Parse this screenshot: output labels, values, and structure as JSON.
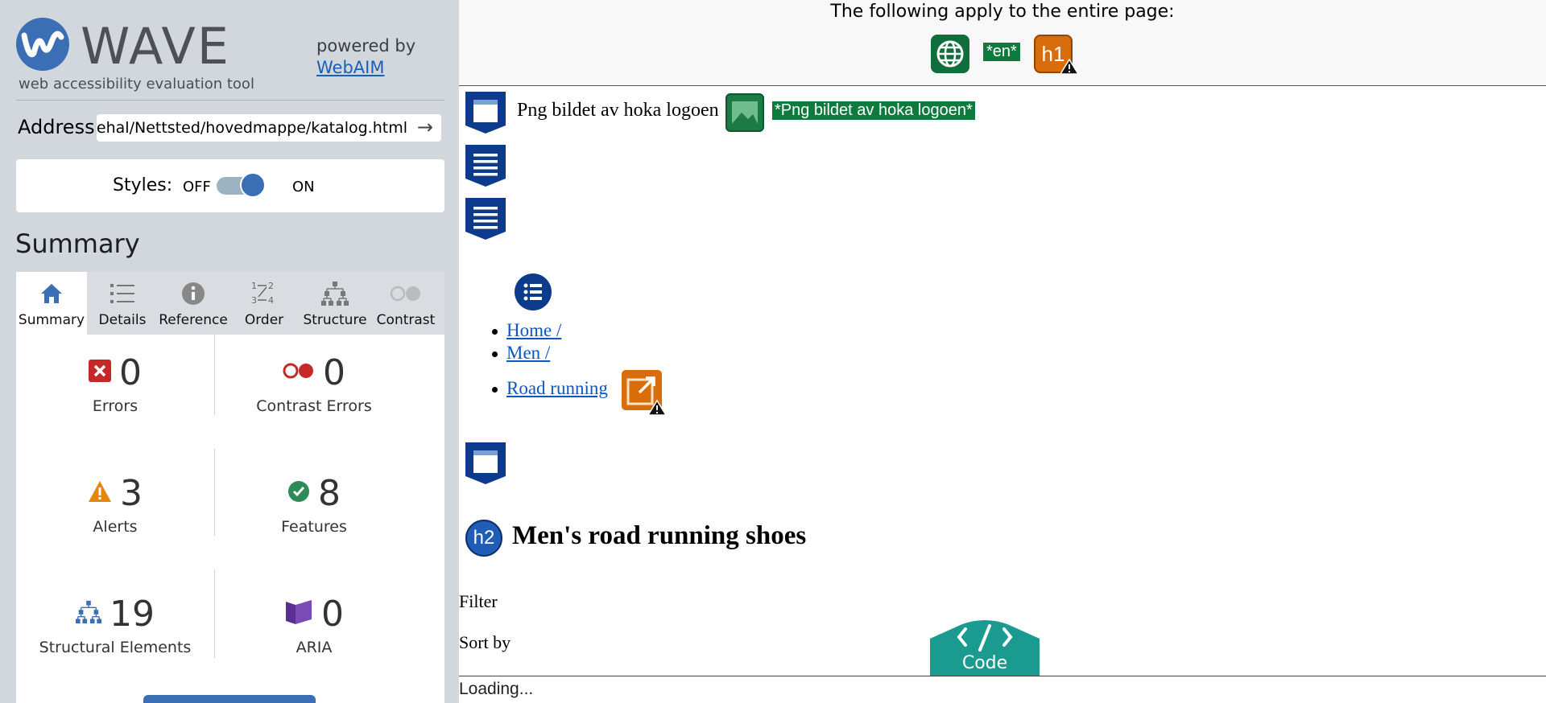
{
  "app": {
    "logo_text": "WAVE",
    "tagline": "web accessibility evaluation tool",
    "powered_by": "powered by",
    "powered_link": "WebAIM"
  },
  "address": {
    "label": "Address:",
    "value": "artehal/Nettsted/hovedmappe/katalog.html",
    "go_icon": "arrow-right-icon"
  },
  "styles": {
    "label": "Styles:",
    "off": "OFF",
    "on": "ON",
    "state": "on"
  },
  "summary": {
    "heading": "Summary",
    "tabs": [
      {
        "label": "Summary",
        "icon": "home-icon",
        "active": true
      },
      {
        "label": "Details",
        "icon": "list-icon",
        "active": false
      },
      {
        "label": "Reference",
        "icon": "info-icon",
        "active": false
      },
      {
        "label": "Order",
        "icon": "order-icon",
        "active": false
      },
      {
        "label": "Structure",
        "icon": "structure-icon",
        "active": false
      },
      {
        "label": "Contrast",
        "icon": "contrast-icon",
        "active": false
      }
    ],
    "stats": [
      {
        "value": "0",
        "label": "Errors",
        "icon": "error-icon",
        "color": "#c62828"
      },
      {
        "value": "0",
        "label": "Contrast Errors",
        "icon": "contrast-error-icon",
        "color": "#c62828"
      },
      {
        "value": "3",
        "label": "Alerts",
        "icon": "alert-icon",
        "color": "#e6860f"
      },
      {
        "value": "8",
        "label": "Features",
        "icon": "feature-icon",
        "color": "#2e8b57"
      },
      {
        "value": "19",
        "label": "Structural Elements",
        "icon": "structure-icon",
        "color": "#3b6fb5"
      },
      {
        "value": "0",
        "label": "ARIA",
        "icon": "aria-icon",
        "color": "#5b2e91"
      }
    ]
  },
  "page": {
    "applies_text": "The following apply to the entire page:",
    "lang_label": "*en*",
    "h1_label": "h1",
    "logo_alt_text": "Png bildet av hoka logoen",
    "img_alt_label": "*Png bildet av hoka logoen*",
    "breadcrumbs": [
      "Home /",
      "Men /",
      "Road running"
    ],
    "h2_label": "h2",
    "heading": "Men's road running shoes",
    "filter": "Filter",
    "sort": "Sort by",
    "code_label": "Code",
    "loading": "Loading..."
  },
  "colors": {
    "accent": "#3b6fb5",
    "feature_green": "#0f7a3e",
    "alert_orange": "#d96d0b",
    "structure_navy": "#0d3b8c"
  }
}
